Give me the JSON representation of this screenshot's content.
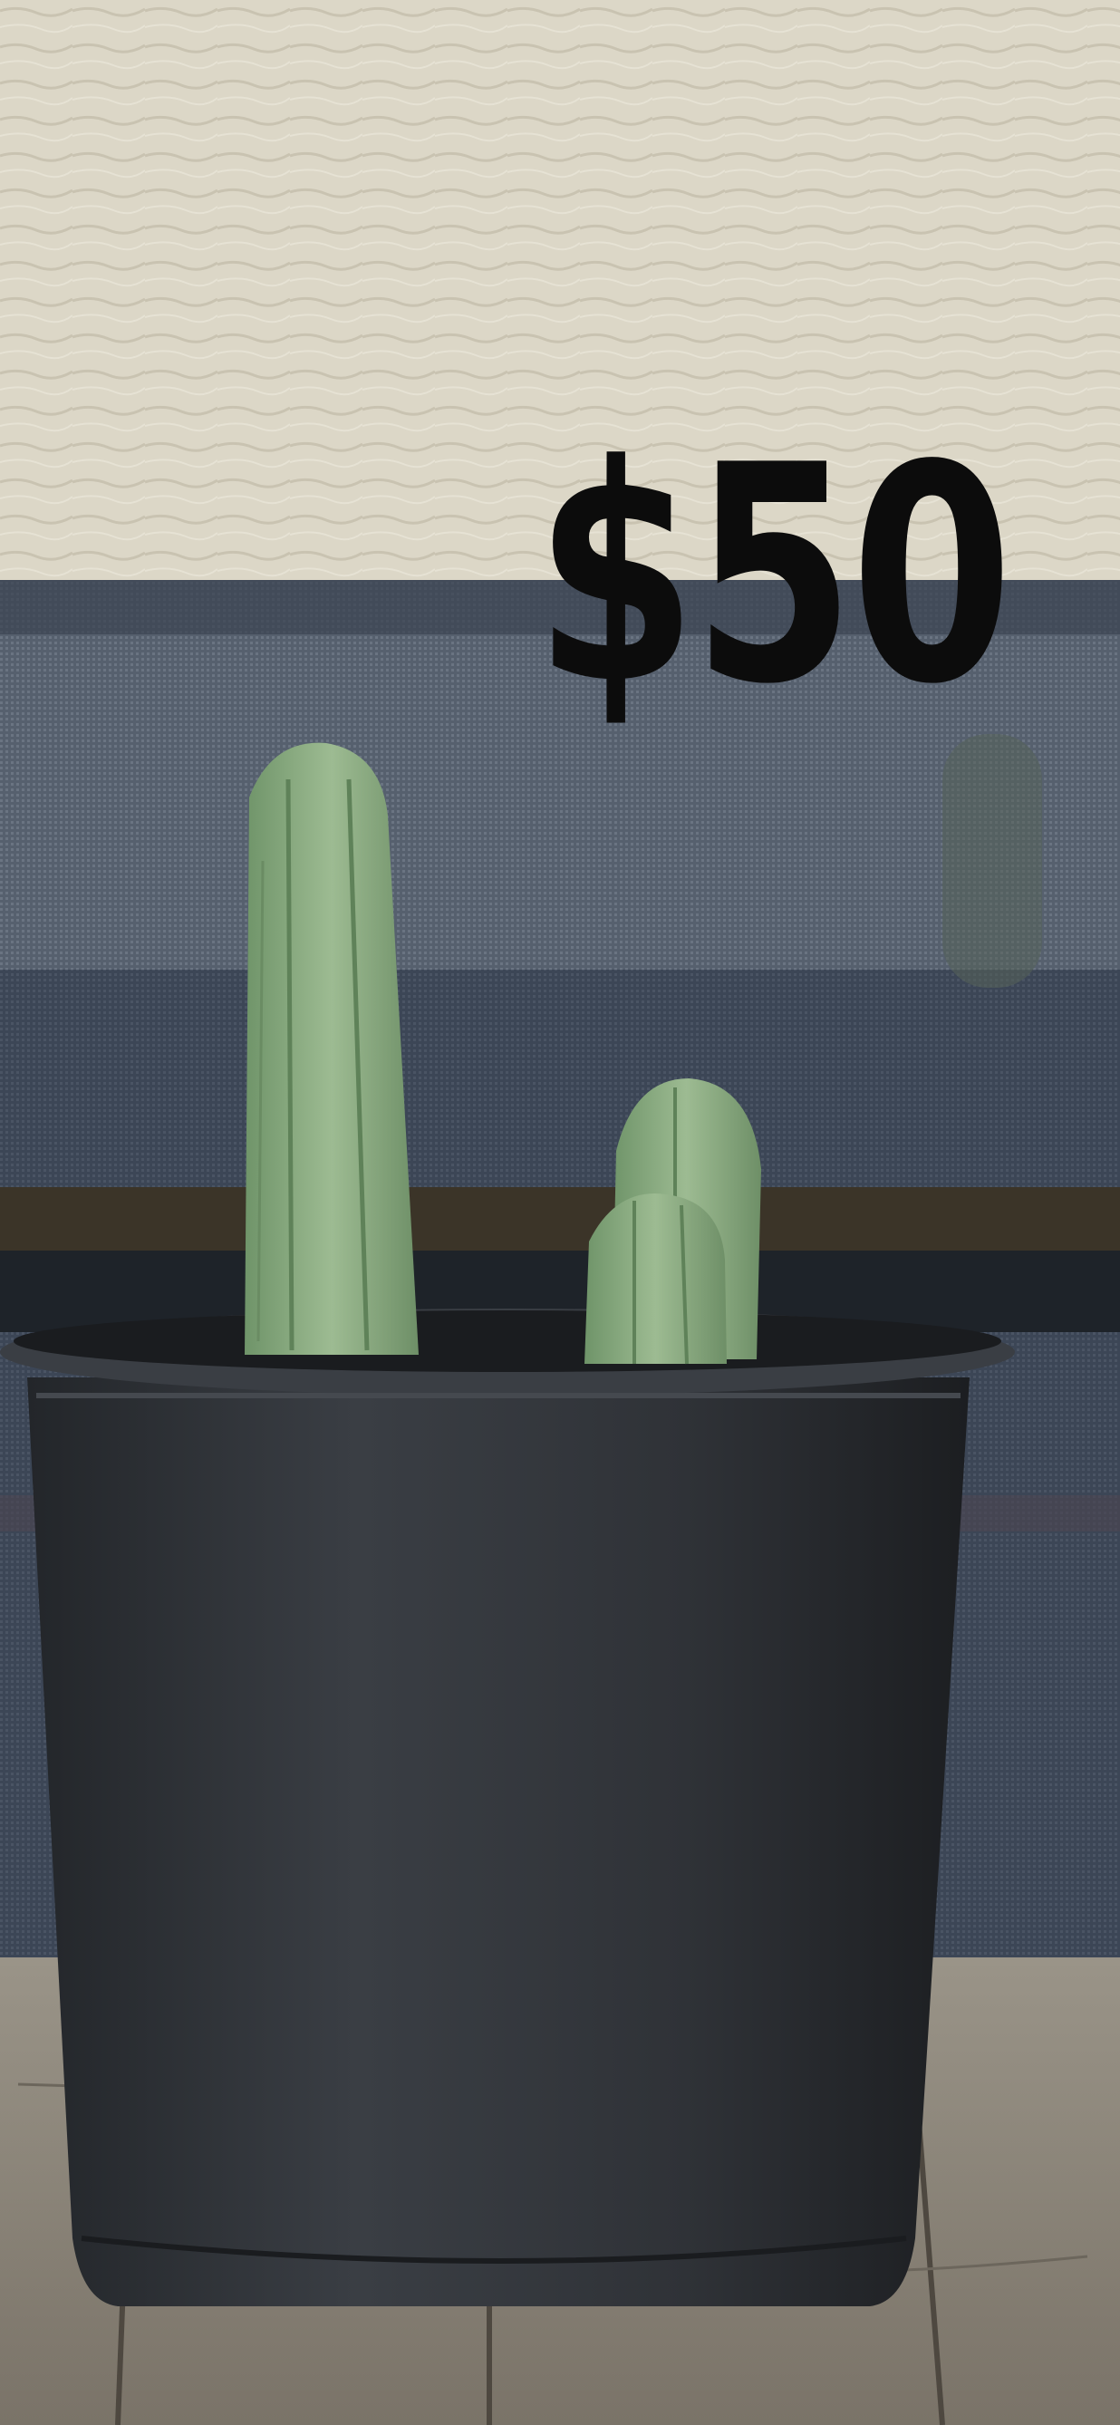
{
  "price_tag": {
    "text": "$50"
  },
  "scene": {
    "subject": "potted-cactus-cuttings",
    "colors": {
      "stucco_wall": "#d9d4c4",
      "shade_cloth": "#4e5866",
      "cactus_green": "#8fae86",
      "pot_black": "#2c2f33",
      "wood_deck": "#8a8478"
    }
  }
}
